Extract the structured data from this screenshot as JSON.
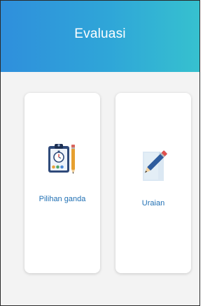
{
  "header": {
    "title": "Evaluasi"
  },
  "cards": [
    {
      "label": "Pilihan ganda",
      "icon": "clipboard-quiz-icon"
    },
    {
      "label": "Uraian",
      "icon": "paper-pencil-icon"
    }
  ],
  "colors": {
    "header_gradient_start": "#2f8fdc",
    "header_gradient_end": "#36c1cf",
    "label_color": "#1f6fb3",
    "background": "#f3f3f3"
  }
}
